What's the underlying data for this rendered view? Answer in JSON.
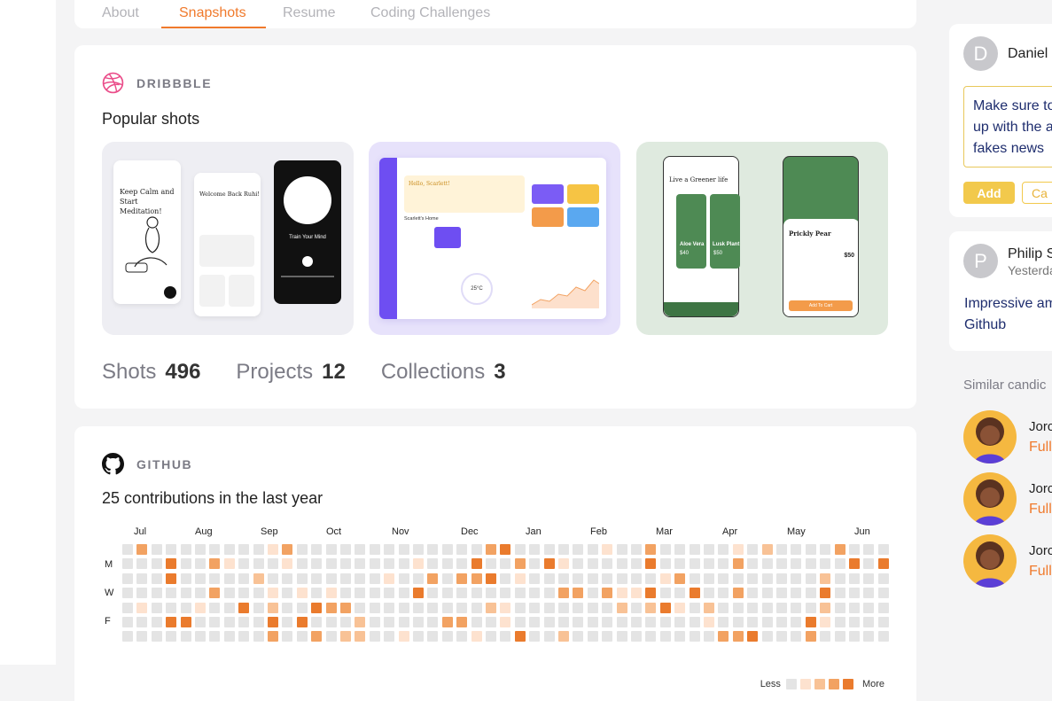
{
  "tabs": [
    {
      "label": "About"
    },
    {
      "label": "Snapshots"
    },
    {
      "label": "Resume"
    },
    {
      "label": "Coding Challenges"
    }
  ],
  "dribbble": {
    "label": "DRIBBBLE",
    "title": "Popular shots",
    "shots": [
      {
        "card_title": "Keep Calm and Start Meditation!",
        "screen2": "Welcome Back Ruhi!",
        "screen3": "Train Your Mind"
      },
      {
        "card_title": "Hello, Scarlett!",
        "home": "Scarlett's Home",
        "temp": "25°C"
      },
      {
        "card_title": "Live a Greener life",
        "p1": "Aloe Vera",
        "p1_price": "$40",
        "p2": "Lusk Plant",
        "p2_price": "$50",
        "detail": "Prickly Pear",
        "detail_price": "$50",
        "cart": "Add To Cart"
      }
    ],
    "stats": [
      {
        "label": "Shots",
        "value": "496"
      },
      {
        "label": "Projects",
        "value": "12"
      },
      {
        "label": "Collections",
        "value": "3"
      }
    ]
  },
  "github": {
    "label": "GITHUB",
    "title": "25 contributions in the last year",
    "months": [
      "Jul",
      "Aug",
      "Sep",
      "Oct",
      "Nov",
      "Dec",
      "Jan",
      "Feb",
      "Mar",
      "Apr",
      "May",
      "Jun"
    ],
    "days": [
      "M",
      "W",
      "F"
    ],
    "legend_less": "Less",
    "legend_more": "More",
    "colors": [
      "#e4e4e4",
      "#fde2cf",
      "#f8c296",
      "#f2a262",
      "#ea7b2d"
    ]
  },
  "comments": [
    {
      "initial": "D",
      "name": "Daniel",
      "draft": [
        "Make sure to",
        "up with the a",
        "fakes news"
      ],
      "add": "Add",
      "cancel": "Ca"
    },
    {
      "initial": "P",
      "name": "Philip S",
      "time": "Yesterda",
      "text": [
        "Impressive am",
        "Github"
      ]
    }
  ],
  "similar": {
    "title": "Similar candic",
    "items": [
      {
        "name": "Jorc",
        "role": "Full"
      },
      {
        "name": "Jorc",
        "role": "Full"
      },
      {
        "name": "Jorc",
        "role": "Full"
      }
    ]
  }
}
